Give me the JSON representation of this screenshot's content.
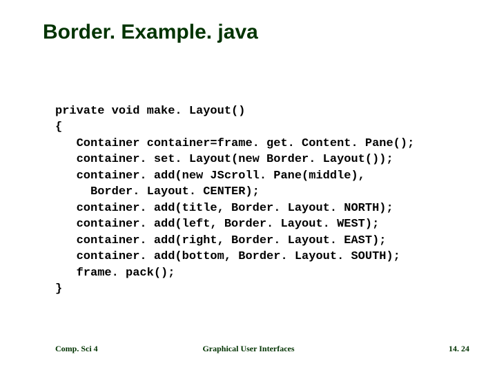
{
  "title": "Border. Example. java",
  "code": "private void make. Layout()\n{\n   Container container=frame. get. Content. Pane();\n   container. set. Layout(new Border. Layout());\n   container. add(new JScroll. Pane(middle),\n     Border. Layout. CENTER);\n   container. add(title, Border. Layout. NORTH);\n   container. add(left, Border. Layout. WEST);\n   container. add(right, Border. Layout. EAST);\n   container. add(bottom, Border. Layout. SOUTH);\n   frame. pack();\n}",
  "footer": {
    "left": "Comp. Sci 4",
    "center": "Graphical User Interfaces",
    "right": "14. 24"
  }
}
